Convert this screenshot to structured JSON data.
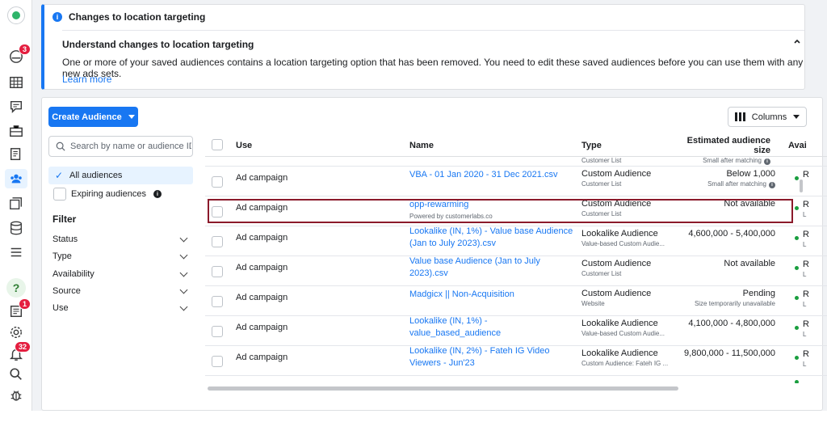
{
  "rail": {
    "badges": {
      "notifications": "3",
      "news": "1",
      "alerts": "32"
    },
    "help": "?"
  },
  "banner": {
    "title": "Changes to location targeting",
    "subtitle": "Understand changes to location targeting",
    "body": "One or more of your saved audiences contains a location targeting option that has been removed. You need to edit these saved audiences before you can use them with any new ads sets.",
    "link": "Learn more",
    "accent": "#1877f2"
  },
  "toolbar": {
    "create_label": "Create Audience",
    "columns_label": "Columns"
  },
  "sidebar": {
    "search_placeholder": "Search by name or audience ID",
    "views": [
      {
        "label": "All audiences"
      },
      {
        "label": "Expiring audiences"
      }
    ],
    "filter_title": "Filter",
    "filters": [
      {
        "label": "Status"
      },
      {
        "label": "Type"
      },
      {
        "label": "Availability"
      },
      {
        "label": "Source"
      },
      {
        "label": "Use"
      }
    ]
  },
  "table": {
    "headers": {
      "use": "Use",
      "name": "Name",
      "type": "Type",
      "size": "Estimated audience size",
      "avail": "Avai"
    },
    "partial_top": {
      "type_sub": "Customer List",
      "size_sub": "Small after matching"
    },
    "rows": [
      {
        "use": "Ad campaign",
        "name": "VBA - 01 Jan 2020 - 31 Dec 2021.csv",
        "name_sub": "",
        "type": "Custom Audience",
        "type_sub": "Customer List",
        "size": "Below 1,000",
        "size_sub": "Small after matching",
        "avail": "R",
        "avail_sub": ""
      },
      {
        "use": "Ad campaign",
        "name": "opp-rewarming",
        "name_sub": "Powered by customerlabs.co",
        "type": "Custom Audience",
        "type_sub": "Customer List",
        "size": "Not available",
        "size_sub": "",
        "avail": "R",
        "avail_sub": "L"
      },
      {
        "use": "Ad campaign",
        "name": "Lookalike (IN, 1%) - Value base Audience (Jan to July 2023).csv",
        "name_sub": "",
        "type": "Lookalike Audience",
        "type_sub": "Value-based Custom Audie...",
        "size": "4,600,000 - 5,400,000",
        "size_sub": "",
        "avail": "R",
        "avail_sub": "L"
      },
      {
        "use": "Ad campaign",
        "name": "Value base Audience (Jan to July 2023).csv",
        "name_sub": "",
        "type": "Custom Audience",
        "type_sub": "Customer List",
        "size": "Not available",
        "size_sub": "",
        "avail": "R",
        "avail_sub": "L"
      },
      {
        "use": "Ad campaign",
        "name": "Madgicx || Non-Acquisition",
        "name_sub": "",
        "type": "Custom Audience",
        "type_sub": "Website",
        "size": "Pending",
        "size_sub": "Size temporarily unavailable",
        "avail": "R",
        "avail_sub": "L"
      },
      {
        "use": "Ad campaign",
        "name": "Lookalike (IN, 1%) - value_based_audience",
        "name_sub": "",
        "type": "Lookalike Audience",
        "type_sub": "Value-based Custom Audie...",
        "size": "4,100,000 - 4,800,000",
        "size_sub": "",
        "avail": "R",
        "avail_sub": "L"
      },
      {
        "use": "Ad campaign",
        "name": "Lookalike (IN, 2%) - Fateh IG Video Viewers - Jun'23",
        "name_sub": "",
        "type": "Lookalike Audience",
        "type_sub": "Custom Audience: Fateh IG ...",
        "size": "9,800,000 - 11,500,000",
        "size_sub": "",
        "avail": "R",
        "avail_sub": "L"
      }
    ]
  }
}
